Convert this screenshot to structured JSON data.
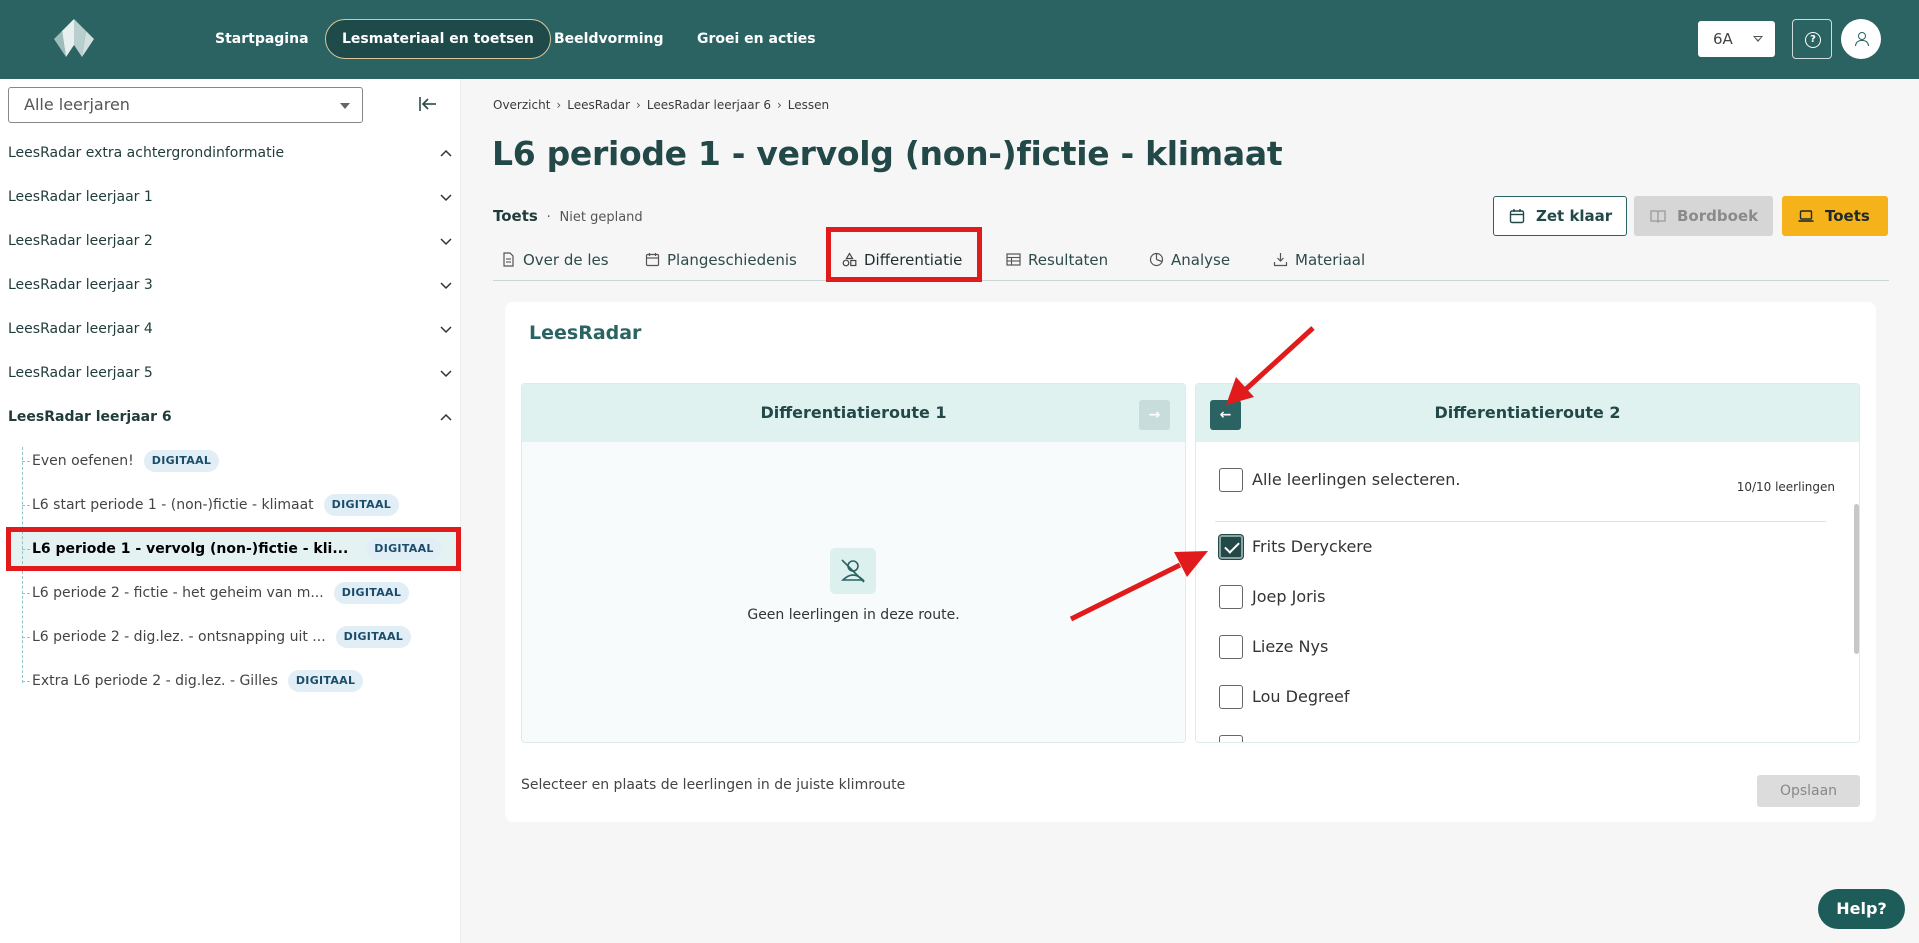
{
  "header": {
    "nav": [
      {
        "label": "Startpagina"
      },
      {
        "label": "Lesmateriaal en toetsen"
      },
      {
        "label": "Beeldvorming"
      },
      {
        "label": "Groei en acties"
      }
    ],
    "class_value": "6A",
    "help_glyph": "?"
  },
  "sidebar": {
    "year_select": "Alle leerjaren",
    "groups": [
      {
        "label": "LeesRadar extra achtergrondinformatie"
      },
      {
        "label": "LeesRadar leerjaar 1"
      },
      {
        "label": "LeesRadar leerjaar 2"
      },
      {
        "label": "LeesRadar leerjaar 3"
      },
      {
        "label": "LeesRadar leerjaar 4"
      },
      {
        "label": "LeesRadar leerjaar 5"
      },
      {
        "label": "LeesRadar leerjaar 6"
      }
    ],
    "lessons": [
      {
        "label": "Even oefenen!",
        "badge": "DIGITAAL"
      },
      {
        "label": "L6 start periode 1 - (non-)fictie - klimaat",
        "badge": "DIGITAAL"
      },
      {
        "label": "L6 periode 1 - vervolg (non-)fictie - kli...",
        "badge": "DIGITAAL"
      },
      {
        "label": "L6 periode 2 - fictie - het geheim van m...",
        "badge": "DIGITAAL"
      },
      {
        "label": "L6 periode 2 - dig.lez. - ontsnapping uit ...",
        "badge": "DIGITAAL"
      },
      {
        "label": "Extra L6 periode 2 - dig.lez. - Gilles",
        "badge": "DIGITAAL"
      }
    ]
  },
  "breadcrumb": [
    "Overzicht",
    "LeesRadar",
    "LeesRadar leerjaar 6",
    "Lessen"
  ],
  "breadcrumb_sep": "›",
  "page": {
    "title": "L6 periode 1 - vervolg (non-)fictie - klimaat",
    "type": "Toets",
    "dot": "·",
    "status": "Niet gepland"
  },
  "actions": {
    "zet_klaar": "Zet klaar",
    "bordboek": "Bordboek",
    "toets": "Toets"
  },
  "tabs": [
    {
      "label": "Over de les"
    },
    {
      "label": "Plangeschiedenis"
    },
    {
      "label": "Differentiatie"
    },
    {
      "label": "Resultaten"
    },
    {
      "label": "Analyse"
    },
    {
      "label": "Materiaal"
    }
  ],
  "differentiation": {
    "title": "LeesRadar",
    "route1": {
      "title": "Differentiatieroute 1",
      "move_glyph": "→",
      "empty_text": "Geen leerlingen in deze route."
    },
    "route2": {
      "title": "Differentiatieroute 2",
      "move_glyph": "←",
      "select_all": "Alle leerlingen selecteren.",
      "count": "10/10 leerlingen",
      "students": [
        {
          "name": "Frits Deryckere",
          "checked": true
        },
        {
          "name": "Joep Joris",
          "checked": false
        },
        {
          "name": "Lieze Nys",
          "checked": false
        },
        {
          "name": "Lou Degreef",
          "checked": false
        }
      ]
    },
    "footer_text": "Selecteer en plaats de leerlingen in de juiste klimroute",
    "save_label": "Opslaan"
  },
  "help_label": "Help?",
  "colors": {
    "header_bg": "#2b6363",
    "accent_yellow": "#f5b21b",
    "annotation_red": "#e11b1b",
    "badge_bg": "#e1eef6"
  }
}
